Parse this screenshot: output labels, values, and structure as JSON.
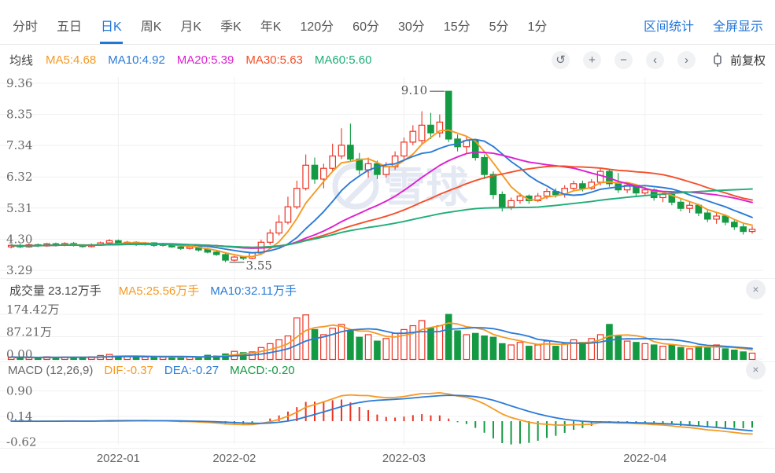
{
  "colors": {
    "accent_blue": "#2176d9",
    "tab_gray": "#555555",
    "axis_gray": "#666666",
    "ma5_orange": "#f59a23",
    "ma10_blue": "#2b7bd6",
    "ma20_magenta": "#dd1fd0",
    "ma30_orangered": "#f4502a",
    "ma60_green": "#1fae77",
    "up_red": "#ec3323",
    "down_green": "#149a43",
    "grid": "#f0f0f1",
    "watermark": "#e3e8f3"
  },
  "tabbar": {
    "tabs": [
      {
        "label": "分时",
        "active": false
      },
      {
        "label": "五日",
        "active": false
      },
      {
        "label": "日K",
        "active": true
      },
      {
        "label": "周K",
        "active": false
      },
      {
        "label": "月K",
        "active": false
      },
      {
        "label": "季K",
        "active": false
      },
      {
        "label": "年K",
        "active": false
      },
      {
        "label": "120分",
        "active": false
      },
      {
        "label": "60分",
        "active": false
      },
      {
        "label": "30分",
        "active": false
      },
      {
        "label": "15分",
        "active": false
      },
      {
        "label": "5分",
        "active": false
      },
      {
        "label": "1分",
        "active": false
      }
    ],
    "links": [
      {
        "label": "区间统计"
      },
      {
        "label": "全屏显示"
      }
    ]
  },
  "legend": {
    "title": "均线",
    "items": [
      {
        "label": "MA5:4.68",
        "color_key": "ma5_orange"
      },
      {
        "label": "MA10:4.92",
        "color_key": "ma10_blue"
      },
      {
        "label": "MA20:5.39",
        "color_key": "ma20_magenta"
      },
      {
        "label": "MA30:5.63",
        "color_key": "ma30_orangered"
      },
      {
        "label": "MA60:5.60",
        "color_key": "ma60_green"
      }
    ]
  },
  "controls": {
    "buttons": [
      {
        "name": "undo-button",
        "glyph": "↺"
      },
      {
        "name": "zoom-in-button",
        "glyph": "+"
      },
      {
        "name": "zoom-out-button",
        "glyph": "−"
      },
      {
        "name": "pan-left-button",
        "glyph": "‹"
      },
      {
        "name": "pan-right-button",
        "glyph": "›"
      },
      {
        "name": "indicator-button",
        "glyph": "candle"
      }
    ],
    "adjust_label": "前复权"
  },
  "volume_header": {
    "title": "成交量 23.12万手",
    "ma5": "MA5:25.56万手",
    "ma10": "MA10:32.11万手",
    "close_glyph": "×"
  },
  "macd_header": {
    "title": "MACD (12,26,9)",
    "dif": "DIF:-0.37",
    "dea": "DEA:-0.27",
    "macd": "MACD:-0.20",
    "close_glyph": "×"
  },
  "watermark_text": "雪球",
  "chart_data": {
    "type": "candlestick",
    "main": {
      "y_ticks": [
        9.36,
        8.35,
        7.34,
        6.32,
        5.31,
        4.3,
        3.29
      ],
      "high_annotation": {
        "index": 49,
        "value": 9.1,
        "label": "9.10"
      },
      "low_annotation": {
        "index": 24,
        "value": 3.55,
        "label": "3.55"
      },
      "ma_periods": [
        5,
        10,
        20,
        30,
        60
      ]
    },
    "volume_panel": {
      "y_tick_labels": [
        "174.42万",
        "87.21万",
        "0.00"
      ],
      "y_max": 174.42,
      "ma_periods": [
        5,
        10
      ]
    },
    "macd_panel": {
      "y_ticks": [
        0.9,
        0.14,
        -0.62
      ],
      "params": [
        12,
        26,
        9
      ]
    },
    "x_ticks": [
      {
        "index": 12,
        "label": "2022-01"
      },
      {
        "index": 25,
        "label": "2022-02"
      },
      {
        "index": 44,
        "label": "2022-03"
      },
      {
        "index": 71,
        "label": "2022-04"
      }
    ],
    "candles": [
      [
        4.05,
        4.14,
        4.0,
        4.1,
        8
      ],
      [
        4.1,
        4.15,
        4.01,
        4.05,
        6
      ],
      [
        4.05,
        4.16,
        4.02,
        4.12,
        7
      ],
      [
        4.12,
        4.16,
        4.04,
        4.08,
        5
      ],
      [
        4.08,
        4.18,
        4.05,
        4.15,
        9
      ],
      [
        4.15,
        4.19,
        4.06,
        4.1,
        6
      ],
      [
        4.1,
        4.2,
        4.07,
        4.16,
        8
      ],
      [
        4.16,
        4.21,
        4.06,
        4.1,
        7
      ],
      [
        4.1,
        4.14,
        4.02,
        4.06,
        6
      ],
      [
        4.06,
        4.16,
        4.03,
        4.12,
        9
      ],
      [
        4.12,
        4.22,
        4.09,
        4.18,
        14
      ],
      [
        4.18,
        4.3,
        4.14,
        4.25,
        18
      ],
      [
        4.25,
        4.29,
        4.12,
        4.15,
        12
      ],
      [
        4.15,
        4.24,
        4.11,
        4.2,
        10
      ],
      [
        4.2,
        4.23,
        4.08,
        4.12,
        9
      ],
      [
        4.12,
        4.21,
        4.09,
        4.18,
        8
      ],
      [
        4.18,
        4.2,
        4.05,
        4.1,
        10
      ],
      [
        4.1,
        4.18,
        4.06,
        4.15,
        7
      ],
      [
        4.15,
        4.17,
        4.02,
        4.05,
        8
      ],
      [
        4.05,
        4.09,
        3.95,
        4.0,
        6
      ],
      [
        4.0,
        4.08,
        3.96,
        4.05,
        9
      ],
      [
        4.05,
        4.07,
        3.9,
        3.95,
        7
      ],
      [
        3.98,
        4.02,
        3.84,
        3.88,
        15
      ],
      [
        3.88,
        3.93,
        3.76,
        3.8,
        12
      ],
      [
        3.8,
        3.85,
        3.55,
        3.62,
        20
      ],
      [
        3.62,
        3.76,
        3.58,
        3.72,
        30
      ],
      [
        3.72,
        3.75,
        3.62,
        3.68,
        25
      ],
      [
        3.68,
        3.88,
        3.65,
        3.85,
        28
      ],
      [
        3.85,
        4.28,
        3.82,
        4.2,
        45
      ],
      [
        4.2,
        4.62,
        4.12,
        4.5,
        60
      ],
      [
        4.5,
        5.08,
        4.42,
        4.85,
        75
      ],
      [
        4.85,
        5.68,
        4.78,
        5.35,
        90
      ],
      [
        5.35,
        6.2,
        5.28,
        5.95,
        160
      ],
      [
        5.95,
        7.05,
        5.88,
        6.7,
        172
      ],
      [
        6.7,
        6.95,
        6.1,
        6.25,
        115
      ],
      [
        6.25,
        6.75,
        5.95,
        6.6,
        95
      ],
      [
        6.6,
        7.4,
        6.5,
        7.0,
        120
      ],
      [
        7.0,
        7.9,
        6.9,
        7.35,
        135
      ],
      [
        7.35,
        8.05,
        6.8,
        6.9,
        110
      ],
      [
        6.9,
        7.1,
        6.4,
        6.55,
        85
      ],
      [
        6.55,
        6.95,
        6.3,
        6.75,
        95
      ],
      [
        6.75,
        6.85,
        6.25,
        6.4,
        70
      ],
      [
        6.4,
        6.8,
        6.3,
        6.65,
        80
      ],
      [
        6.65,
        7.15,
        6.55,
        7.0,
        100
      ],
      [
        7.0,
        7.6,
        6.9,
        7.45,
        115
      ],
      [
        7.45,
        8.0,
        7.35,
        7.8,
        130
      ],
      [
        7.5,
        8.45,
        7.4,
        8.0,
        150
      ],
      [
        8.0,
        8.4,
        7.55,
        7.75,
        120
      ],
      [
        7.75,
        8.35,
        7.6,
        8.1,
        130
      ],
      [
        9.1,
        9.1,
        7.45,
        7.55,
        174
      ],
      [
        7.55,
        7.7,
        7.15,
        7.3,
        110
      ],
      [
        7.3,
        7.65,
        7.1,
        7.5,
        95
      ],
      [
        7.5,
        7.55,
        6.85,
        6.95,
        100
      ],
      [
        6.95,
        7.05,
        6.25,
        6.4,
        90
      ],
      [
        6.4,
        6.5,
        5.6,
        5.75,
        85
      ],
      [
        5.75,
        5.85,
        5.2,
        5.35,
        60
      ],
      [
        5.35,
        5.65,
        5.25,
        5.55,
        55
      ],
      [
        5.55,
        5.8,
        5.45,
        5.7,
        65
      ],
      [
        5.7,
        5.75,
        5.45,
        5.55,
        50
      ],
      [
        5.55,
        5.8,
        5.5,
        5.7,
        55
      ],
      [
        5.7,
        5.95,
        5.6,
        5.85,
        70
      ],
      [
        5.85,
        5.95,
        5.65,
        5.75,
        50
      ],
      [
        5.75,
        6.05,
        5.65,
        5.95,
        60
      ],
      [
        5.95,
        6.2,
        5.85,
        6.1,
        75
      ],
      [
        6.1,
        6.2,
        5.85,
        5.95,
        65
      ],
      [
        5.95,
        6.25,
        5.9,
        6.15,
        80
      ],
      [
        6.15,
        6.6,
        6.05,
        6.5,
        95
      ],
      [
        6.5,
        6.55,
        6.0,
        6.1,
        135
      ],
      [
        6.1,
        6.45,
        5.8,
        5.9,
        90
      ],
      [
        5.9,
        6.15,
        5.8,
        6.05,
        70
      ],
      [
        6.05,
        6.1,
        5.7,
        5.8,
        65
      ],
      [
        5.8,
        6.0,
        5.7,
        5.9,
        60
      ],
      [
        5.9,
        5.95,
        5.55,
        5.65,
        55
      ],
      [
        5.65,
        5.85,
        5.5,
        5.75,
        50
      ],
      [
        5.75,
        5.8,
        5.4,
        5.5,
        55
      ],
      [
        5.5,
        5.6,
        5.2,
        5.3,
        45
      ],
      [
        5.3,
        5.5,
        5.15,
        5.4,
        40
      ],
      [
        5.4,
        5.45,
        5.05,
        5.15,
        50
      ],
      [
        5.15,
        5.25,
        4.85,
        4.95,
        45
      ],
      [
        4.95,
        5.15,
        4.8,
        5.05,
        55
      ],
      [
        5.05,
        5.1,
        4.75,
        4.85,
        40
      ],
      [
        4.85,
        4.95,
        4.6,
        4.7,
        35
      ],
      [
        4.7,
        4.8,
        4.45,
        4.55,
        28
      ],
      [
        4.55,
        4.72,
        4.48,
        4.62,
        23.12
      ]
    ]
  }
}
